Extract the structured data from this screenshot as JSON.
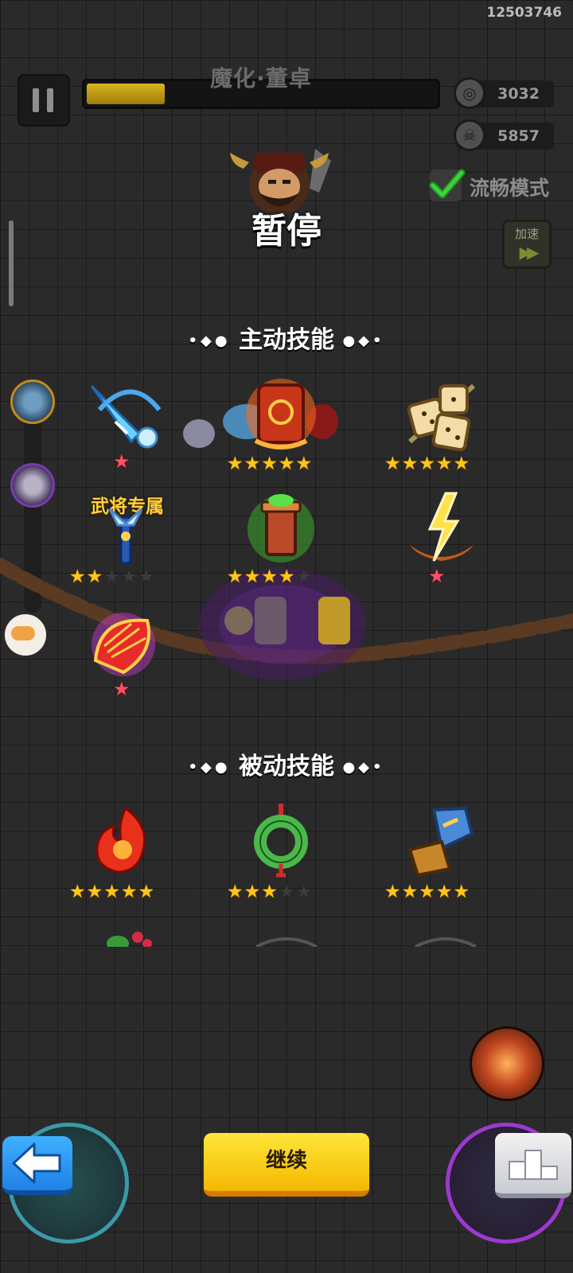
{
  "player_id": "12503746",
  "boss": {
    "name": "魔化·董卓",
    "health_fraction": 0.22
  },
  "counters": {
    "coins": "3032",
    "kills": "5857"
  },
  "smooth_mode": {
    "label": "流畅模式",
    "checked": true
  },
  "speed_button": {
    "label": "加速"
  },
  "pause_title": "暂停",
  "active_skills": {
    "title": "主动技能",
    "exclusive_label": "武将专属",
    "items": [
      {
        "icon": "ice-sword-icon",
        "stars": 0,
        "red_star": true
      },
      {
        "icon": "fire-scroll-icon",
        "stars": 5,
        "red_star": false
      },
      {
        "icon": "dice-icon",
        "stars": 5,
        "red_star": false
      },
      {
        "icon": "ice-scepter-icon",
        "stars": 2,
        "red_star": false,
        "exclusive": true
      },
      {
        "icon": "poison-tower-icon",
        "stars": 4,
        "red_star": false
      },
      {
        "icon": "lightning-icon",
        "stars": 0,
        "red_star": true
      },
      {
        "icon": "phoenix-fan-icon",
        "stars": 0,
        "red_star": true
      }
    ]
  },
  "passive_skills": {
    "title": "被动技能",
    "items": [
      {
        "icon": "fire-spirit-icon",
        "stars": 5
      },
      {
        "icon": "jade-pendant-icon",
        "stars": 3
      },
      {
        "icon": "gauntlet-icon",
        "stars": 5
      }
    ]
  },
  "buttons": {
    "continue": "继续"
  },
  "colors": {
    "accent_yellow": "#ffd21a",
    "star_gold": "#ffc61a",
    "red_star": "#ff4f6a",
    "back_blue": "#2f9bf5"
  }
}
